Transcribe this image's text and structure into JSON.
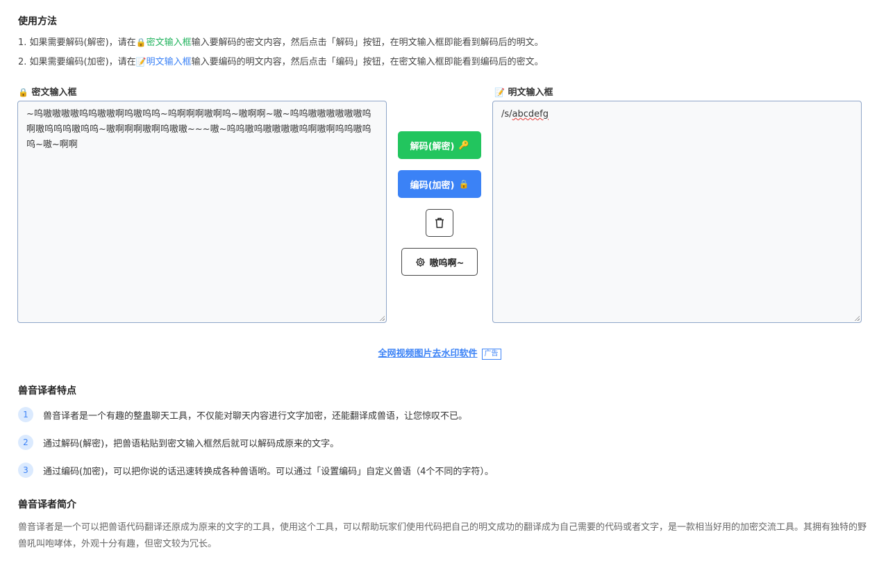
{
  "usage": {
    "title": "使用方法",
    "line1": {
      "pre": "1. 如果需要解码(解密)，请在",
      "icon": "🔒",
      "highlight": "密文输入框",
      "post": "输入要解码的密文内容，然后点击「解码」按钮，在明文输入框即能看到解码后的明文。"
    },
    "line2": {
      "pre": "2. 如果需要编码(加密)，请在",
      "icon": "📝",
      "highlight": "明文输入框",
      "post": "输入要编码的明文内容，然后点击「编码」按钮，在密文输入框即能看到编码后的密文。"
    }
  },
  "cipher_panel": {
    "icon": "🔒",
    "label": "密文输入框",
    "value": "~呜嗷嗷嗷嗷呜呜嗷嗷啊呜嗷呜呜~呜啊啊啊嗷啊呜~嗷啊啊~嗷~呜呜嗷嗷嗷嗷嗷嗷呜啊嗷呜呜呜嗷呜呜~嗷啊啊啊嗷啊呜嗷嗷~~~嗷~呜呜嗷呜嗷嗷嗷嗷呜啊嗷啊呜呜嗷呜呜~嗷~啊啊"
  },
  "plain_panel": {
    "icon": "📝",
    "label": "明文输入框",
    "value_prefix": "/s/",
    "value_misspelled": "abcdefg"
  },
  "actions": {
    "decode_label": "解码(解密)",
    "decode_icon": "🔑",
    "encode_label": "编码(加密)",
    "encode_icon": "🔒",
    "clear_icon": "trash-icon",
    "settings_icon": "gear-icon",
    "settings_label": "嗷呜啊~"
  },
  "ad": {
    "link_text": "全网视频图片去水印软件",
    "tag": "广告"
  },
  "features": {
    "title": "兽音译者特点",
    "items": [
      {
        "num": "1",
        "text": "兽音译者是一个有趣的整蛊聊天工具，不仅能对聊天内容进行文字加密，还能翻译成兽语，让您惊叹不已。"
      },
      {
        "num": "2",
        "text": "通过解码(解密)，把兽语粘贴到密文输入框然后就可以解码成原来的文字。"
      },
      {
        "num": "3",
        "text": "通过编码(加密)，可以把你说的话迅速转换成各种兽语哟。可以通过「设置编码」自定义兽语（4个不同的字符）。"
      }
    ]
  },
  "intro": {
    "title": "兽音译者简介",
    "text": "兽音译者是一个可以把兽语代码翻译还原成为原来的文字的工具，使用这个工具，可以帮助玩家们使用代码把自己的明文成功的翻译成为自己需要的代码或者文字，是一款相当好用的加密交流工具。其拥有独特的野兽吼叫咆哮体，外观十分有趣，但密文较为冗长。"
  },
  "colors": {
    "green": "#22c55e",
    "blue": "#3b82f6"
  }
}
